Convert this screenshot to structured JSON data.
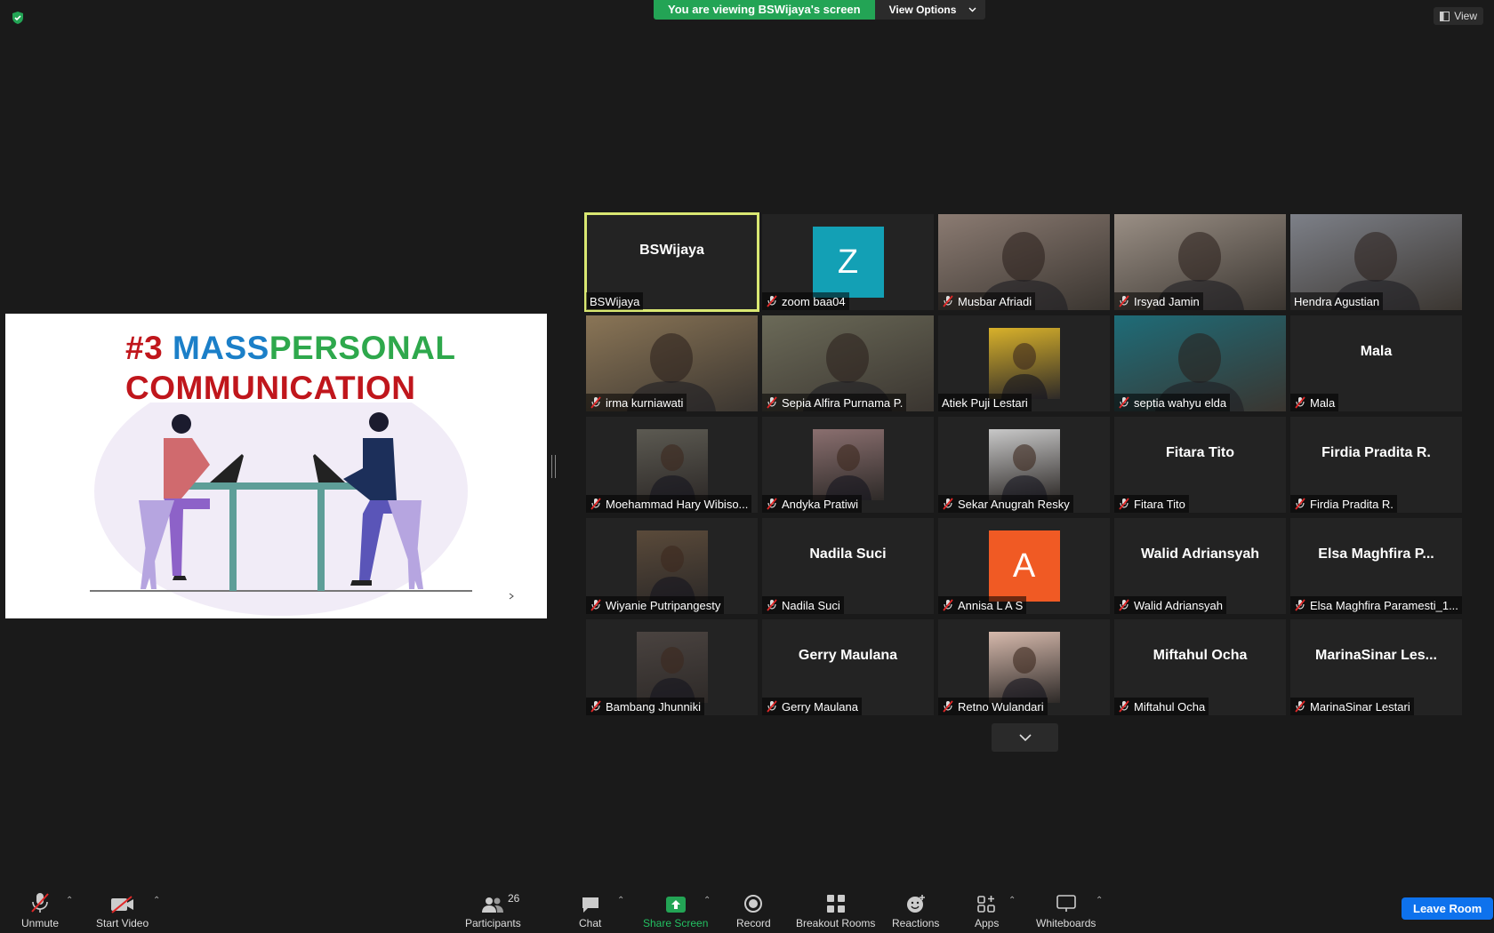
{
  "banner": {
    "viewing_text": "You are viewing BSWijaya's screen",
    "view_options": "View Options"
  },
  "top_right": {
    "view_label": "View"
  },
  "slide": {
    "title_num": "#3",
    "title_mass": "MASS",
    "title_personal": "PERSONAL",
    "title_line2": "COMMUNICATION"
  },
  "tiles": [
    {
      "name": "BSWijaya",
      "big": "BSWijaya",
      "muted": false,
      "kind": "name",
      "active": true
    },
    {
      "name": "zoom baa04",
      "muted": true,
      "kind": "letter",
      "letter": "Z",
      "color": "#13a0b5"
    },
    {
      "name": "Musbar Afriadi",
      "muted": true,
      "kind": "video",
      "color": "#8b7b72"
    },
    {
      "name": "Irsyad Jamin",
      "muted": true,
      "kind": "video",
      "color": "#9a8f85"
    },
    {
      "name": "Hendra Agustian",
      "muted": false,
      "kind": "video",
      "color": "#7d8088"
    },
    {
      "name": "irma kurniawati",
      "muted": true,
      "kind": "video",
      "color": "#8a7556"
    },
    {
      "name": "Sepia Alfira Purnama P.",
      "muted": true,
      "kind": "video",
      "color": "#6b6a58"
    },
    {
      "name": "Atiek Puji Lestari",
      "muted": false,
      "kind": "thumb",
      "color": "#d8b12a"
    },
    {
      "name": "septia wahyu elda",
      "muted": true,
      "kind": "video",
      "color": "#1e6c78"
    },
    {
      "name": "Mala",
      "big": "Mala",
      "muted": true,
      "kind": "name"
    },
    {
      "name": "Moehammad Hary Wibiso...",
      "muted": true,
      "kind": "thumb",
      "color": "#5c5a52"
    },
    {
      "name": "Andyka Pratiwi",
      "muted": true,
      "kind": "thumb",
      "color": "#8a6f6f"
    },
    {
      "name": "Sekar Anugrah Resky",
      "muted": true,
      "kind": "thumb",
      "color": "#c8c8c8"
    },
    {
      "name": "Fitara Tito",
      "big": "Fitara Tito",
      "muted": true,
      "kind": "name"
    },
    {
      "name": "Firdia Pradita R.",
      "big": "Firdia Pradita R.",
      "muted": true,
      "kind": "name"
    },
    {
      "name": "Wiyanie Putripangesty",
      "muted": true,
      "kind": "thumb",
      "color": "#5a4a3a"
    },
    {
      "name": "Nadila Suci",
      "big": "Nadila Suci",
      "muted": true,
      "kind": "name"
    },
    {
      "name": "Annisa L A S",
      "muted": true,
      "kind": "letter",
      "letter": "A",
      "color": "#f05a24"
    },
    {
      "name": "Walid Adriansyah",
      "big": "Walid Adriansyah",
      "muted": true,
      "kind": "name"
    },
    {
      "name": "Elsa Maghfira Paramesti_1...",
      "big": "Elsa  Maghfira  P...",
      "muted": true,
      "kind": "name"
    },
    {
      "name": "Bambang Jhunniki",
      "muted": true,
      "kind": "thumb",
      "color": "#4a4340"
    },
    {
      "name": "Gerry Maulana",
      "big": "Gerry Maulana",
      "muted": true,
      "kind": "name"
    },
    {
      "name": "Retno Wulandari",
      "muted": true,
      "kind": "thumb",
      "color": "#d6b9ac"
    },
    {
      "name": "Miftahul Ocha",
      "big": "Miftahul Ocha",
      "muted": true,
      "kind": "name"
    },
    {
      "name": "MarinaSinar Lestari",
      "big": "MarinaSinar  Les...",
      "muted": true,
      "kind": "name"
    }
  ],
  "toolbar": {
    "unmute": "Unmute",
    "start_video": "Start Video",
    "participants": "Participants",
    "participants_count": "26",
    "chat": "Chat",
    "share_screen": "Share Screen",
    "record": "Record",
    "breakout_rooms": "Breakout Rooms",
    "reactions": "Reactions",
    "apps": "Apps",
    "whiteboards": "Whiteboards",
    "leave_room": "Leave Room"
  },
  "colors": {
    "share_green": "#23a455",
    "leave_blue": "#0e72ed",
    "active_border": "#d9e772",
    "mute_red": "#e02828"
  }
}
